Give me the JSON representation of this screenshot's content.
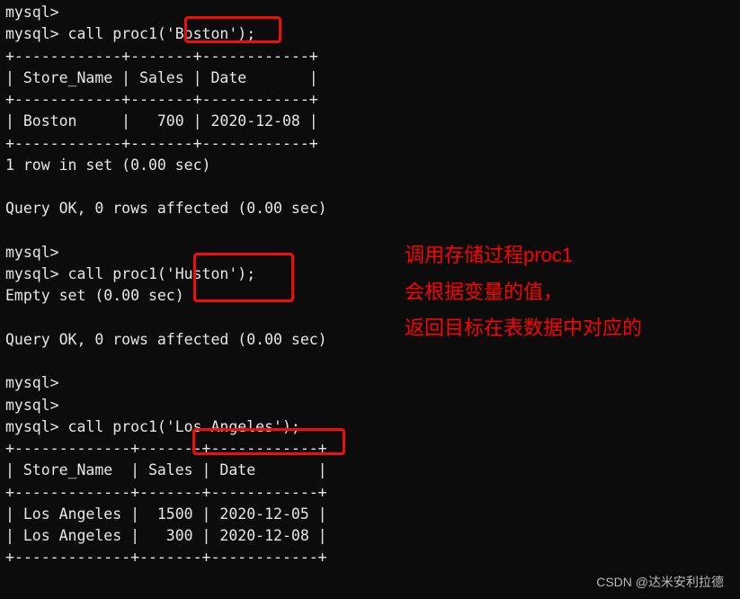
{
  "term": {
    "l0": "mysql>",
    "l1": "mysql> call proc1('Boston');",
    "l2": "+------------+-------+------------+",
    "l3": "| Store_Name | Sales | Date       |",
    "l4": "+------------+-------+------------+",
    "l5": "| Boston     |   700 | 2020-12-08 |",
    "l6": "+------------+-------+------------+",
    "l7": "1 row in set (0.00 sec)",
    "l8": "",
    "l9": "Query OK, 0 rows affected (0.00 sec)",
    "l10": "",
    "l11": "mysql>",
    "l12": "mysql> call proc1('Huston');",
    "l13": "Empty set (0.00 sec)",
    "l14": "",
    "l15": "Query OK, 0 rows affected (0.00 sec)",
    "l16": "",
    "l17": "mysql>",
    "l18": "mysql>",
    "l19": "mysql> call proc1('Los Angeles');",
    "l20": "+-------------+-------+------------+",
    "l21": "| Store_Name  | Sales | Date       |",
    "l22": "+-------------+-------+------------+",
    "l23": "| Los Angeles |  1500 | 2020-12-05 |",
    "l24": "| Los Angeles |   300 | 2020-12-08 |",
    "l25": "+-------------+-------+------------+"
  },
  "annotation": {
    "line1": "调用存储过程proc1",
    "line2": "会根据变量的值，",
    "line3": "返回目标在表数据中对应的"
  },
  "watermark": "CSDN @达米安利拉德"
}
